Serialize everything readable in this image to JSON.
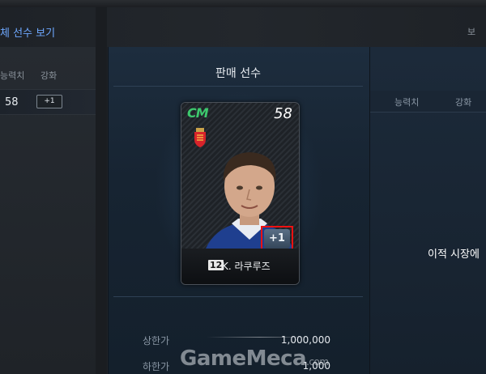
{
  "left": {
    "title": "체 선수 보기",
    "headers": {
      "ability": "능력치",
      "enhance": "강화"
    },
    "row": {
      "ability": "58",
      "enhance": "+1"
    }
  },
  "center": {
    "title": "판매 선수",
    "card": {
      "position": "CM",
      "overall": "58",
      "enhance": "+1",
      "back_number": "12",
      "name": "K. 라쿠루즈",
      "position_color": "#3dc86d"
    },
    "prices": [
      {
        "label": "상한가",
        "value": "1,000,000"
      },
      {
        "label": "하한가",
        "value": "1,000"
      }
    ]
  },
  "right": {
    "corner": "보",
    "headers": {
      "ability": "능력치",
      "enhance": "강화"
    },
    "message": "이적 시장에"
  },
  "watermark": {
    "brand": "GameMeca",
    "suffix": ".com"
  },
  "colors": {
    "accent": "#6ea8ff",
    "highlight_border": "#e11111"
  }
}
